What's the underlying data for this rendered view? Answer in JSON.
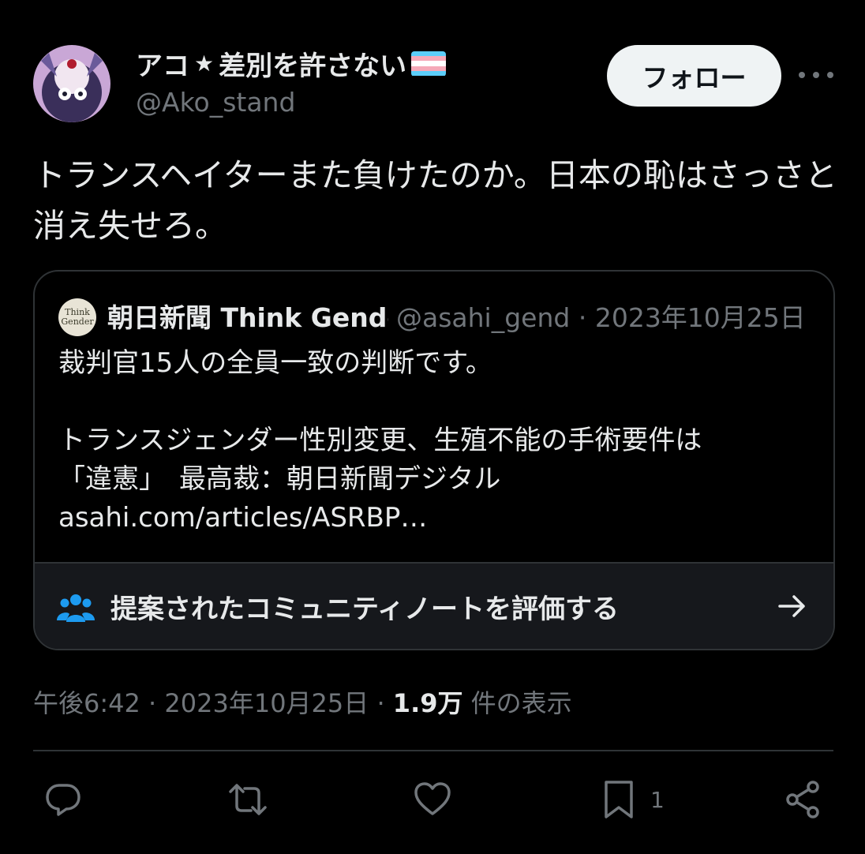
{
  "author": {
    "display_name": "アコ",
    "display_name_rest": "差別を許さない",
    "handle": "@Ako_stand",
    "flag_colors": [
      "#5bcefa",
      "#f5a9b8",
      "#ffffff",
      "#f5a9b8",
      "#5bcefa"
    ]
  },
  "follow_label": "フォロー",
  "tweet_text": "トランスヘイターまた負けたのか。日本の恥はさっさと消え失せろ。",
  "quote": {
    "avatar_text": "Think Gender",
    "name": "朝日新聞 Think Gender",
    "handle": "@asahi_gend",
    "date": "2023年10月25日",
    "text": "裁判官15人の全員一致の判断です。\n\nトランスジェンダー性別変更、生殖不能の手術要件は\n「違憲」　最高裁：朝日新聞デジタル\nasahi.com/articles/ASRBP…",
    "community_note": "提案されたコミュニティノートを評価する"
  },
  "meta": {
    "time": "午後6:42",
    "date": "2023年10月25日",
    "views": "1.9万",
    "views_label": "件の表示"
  },
  "actions": {
    "bookmark_count": "1"
  },
  "colors": {
    "background": "#000000",
    "text": "#e7e9ea",
    "secondary": "#71767b",
    "border": "#2f3336",
    "accent_blue": "#1d9bf0"
  }
}
